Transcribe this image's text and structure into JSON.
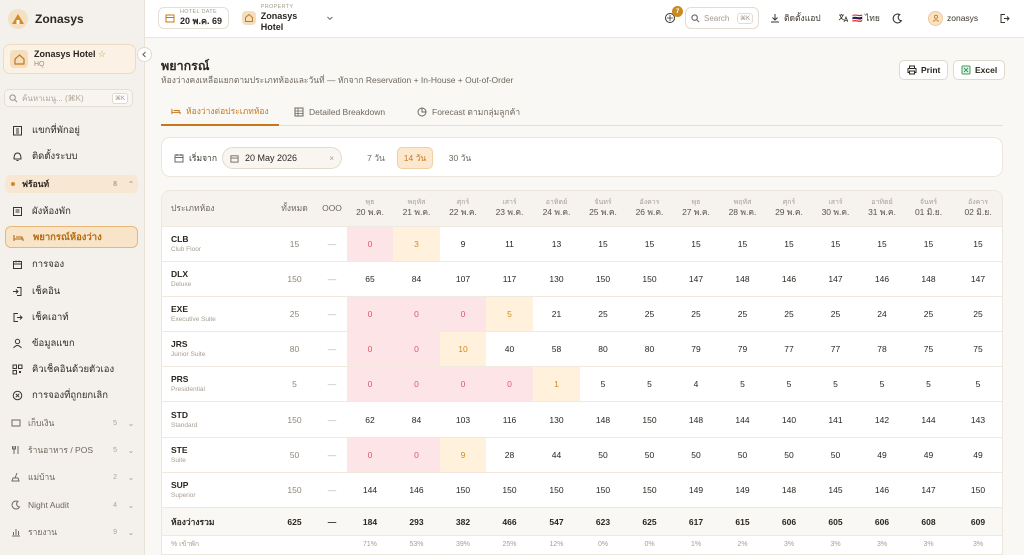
{
  "sidebar": {
    "brand": "Zonasys",
    "hotel_name": "Zonasys Hotel",
    "hotel_sub": "HQ",
    "search_placeholder": "ค้นหาเมนู... (⌘K)",
    "search_kbd": "⌘K",
    "items_top": [
      {
        "label": "แขกที่พักอยู่",
        "icon": "building-icon"
      },
      {
        "label": "ติดตั้งระบบ",
        "icon": "bell-icon"
      }
    ],
    "group_frontdesk": {
      "label": "ฟร้อนท์",
      "count": "8"
    },
    "items_frontdesk": [
      {
        "label": "ผังห้องพัก",
        "icon": "room-plan-icon"
      },
      {
        "label": "พยากรณ์ห้องว่าง",
        "icon": "bed-icon"
      },
      {
        "label": "การจอง",
        "icon": "calendar-icon"
      },
      {
        "label": "เช็คอิน",
        "icon": "check-in-icon"
      },
      {
        "label": "เช็คเอาท์",
        "icon": "check-out-icon"
      },
      {
        "label": "ข้อมูลแขก",
        "icon": "user-icon"
      },
      {
        "label": "คิวเช็คอินด้วยตัวเอง",
        "icon": "qr-icon"
      },
      {
        "label": "การจองที่ถูกยกเลิก",
        "icon": "cancel-icon"
      }
    ],
    "groups": [
      {
        "label": "เก็บเงิน",
        "count": "5"
      },
      {
        "label": "ร้านอาหาร / POS",
        "count": "5"
      },
      {
        "label": "แม่บ้าน",
        "count": "2"
      },
      {
        "label": "Night Audit",
        "count": "4"
      },
      {
        "label": "รายงาน",
        "count": "9"
      }
    ]
  },
  "topbar": {
    "hotel_date_label": "HOTEL DATE",
    "hotel_date": "20 พ.ค. 69",
    "property_label": "PROPERTY",
    "property": "Zonasys Hotel",
    "notif_count": "7",
    "search_placeholder": "Search",
    "search_kbd": "⌘K",
    "install": "ติดตั้งแอป",
    "lang": "🇹🇭 ไทย",
    "user": "zonasys"
  },
  "page": {
    "title": "พยากรณ์",
    "subtitle": "ห้องว่างคงเหลือแยกตามประเภทห้องและวันที่ — หักจาก Reservation + In-House + Out-of-Order",
    "print": "Print",
    "excel": "Excel",
    "tabs": [
      "ห้องว่างต่อประเภทห้อง",
      "Detailed Breakdown",
      "Forecast ตามกลุ่มลูกค้า"
    ]
  },
  "filter": {
    "from_label": "เริ่มจาก",
    "from_date": "20 May 2026",
    "ranges": [
      "7 วัน",
      "14 วัน",
      "30 วัน"
    ],
    "active_range": "14 วัน"
  },
  "table": {
    "col_type": "ประเภทห้อง",
    "col_total": "ทั้งหมด",
    "col_ooo": "OOO",
    "dates": [
      {
        "day": "พุธ",
        "date": "20 พ.ค."
      },
      {
        "day": "พฤหัส",
        "date": "21 พ.ค."
      },
      {
        "day": "ศุกร์",
        "date": "22 พ.ค."
      },
      {
        "day": "เสาร์",
        "date": "23 พ.ค."
      },
      {
        "day": "อาทิตย์",
        "date": "24 พ.ค."
      },
      {
        "day": "จันทร์",
        "date": "25 พ.ค."
      },
      {
        "day": "อังคาร",
        "date": "26 พ.ค."
      },
      {
        "day": "พุธ",
        "date": "27 พ.ค."
      },
      {
        "day": "พฤหัส",
        "date": "28 พ.ค."
      },
      {
        "day": "ศุกร์",
        "date": "29 พ.ค."
      },
      {
        "day": "เสาร์",
        "date": "30 พ.ค."
      },
      {
        "day": "อาทิตย์",
        "date": "31 พ.ค."
      },
      {
        "day": "จันทร์",
        "date": "01 มิ.ย."
      },
      {
        "day": "อังคาร",
        "date": "02 มิ.ย."
      }
    ],
    "rows": [
      {
        "code": "CLB",
        "name": "Club Floor",
        "total": "15",
        "ooo": "—",
        "values": [
          "0",
          "3",
          "9",
          "11",
          "13",
          "15",
          "15",
          "15",
          "15",
          "15",
          "15",
          "15",
          "15",
          "15"
        ]
      },
      {
        "code": "DLX",
        "name": "Deluxe",
        "total": "150",
        "ooo": "—",
        "values": [
          "65",
          "84",
          "107",
          "117",
          "130",
          "150",
          "150",
          "147",
          "148",
          "146",
          "147",
          "146",
          "148",
          "147"
        ]
      },
      {
        "code": "EXE",
        "name": "Executive Suite",
        "total": "25",
        "ooo": "—",
        "values": [
          "0",
          "0",
          "0",
          "5",
          "21",
          "25",
          "25",
          "25",
          "25",
          "25",
          "25",
          "24",
          "25",
          "25"
        ]
      },
      {
        "code": "JRS",
        "name": "Junior Suite",
        "total": "80",
        "ooo": "—",
        "values": [
          "0",
          "0",
          "10",
          "40",
          "58",
          "80",
          "80",
          "79",
          "79",
          "77",
          "77",
          "78",
          "75",
          "75"
        ]
      },
      {
        "code": "PRS",
        "name": "Presidential",
        "total": "5",
        "ooo": "—",
        "values": [
          "0",
          "0",
          "0",
          "0",
          "1",
          "5",
          "5",
          "4",
          "5",
          "5",
          "5",
          "5",
          "5",
          "5"
        ]
      },
      {
        "code": "STD",
        "name": "Standard",
        "total": "150",
        "ooo": "—",
        "values": [
          "62",
          "84",
          "103",
          "116",
          "130",
          "148",
          "150",
          "148",
          "144",
          "140",
          "141",
          "142",
          "144",
          "143"
        ]
      },
      {
        "code": "STE",
        "name": "Suite",
        "total": "50",
        "ooo": "—",
        "values": [
          "0",
          "0",
          "9",
          "28",
          "44",
          "50",
          "50",
          "50",
          "50",
          "50",
          "50",
          "49",
          "49",
          "49"
        ]
      },
      {
        "code": "SUP",
        "name": "Superior",
        "total": "150",
        "ooo": "—",
        "values": [
          "144",
          "146",
          "150",
          "150",
          "150",
          "150",
          "150",
          "149",
          "149",
          "148",
          "145",
          "146",
          "147",
          "150"
        ]
      }
    ],
    "total_row": {
      "label": "ห้องว่างรวม",
      "total": "625",
      "ooo": "—",
      "values": [
        "184",
        "293",
        "382",
        "466",
        "547",
        "623",
        "625",
        "617",
        "615",
        "606",
        "605",
        "606",
        "608",
        "609"
      ]
    },
    "occ_row": {
      "label": "% เข้าพัก",
      "values": [
        "71%",
        "53%",
        "39%",
        "25%",
        "12%",
        "0%",
        "0%",
        "1%",
        "2%",
        "3%",
        "3%",
        "3%",
        "3%",
        "3%"
      ]
    }
  },
  "colors": {
    "accent": "#c7781a",
    "zero_bg": "#fde4e7",
    "low_bg": "#fff1dc"
  }
}
